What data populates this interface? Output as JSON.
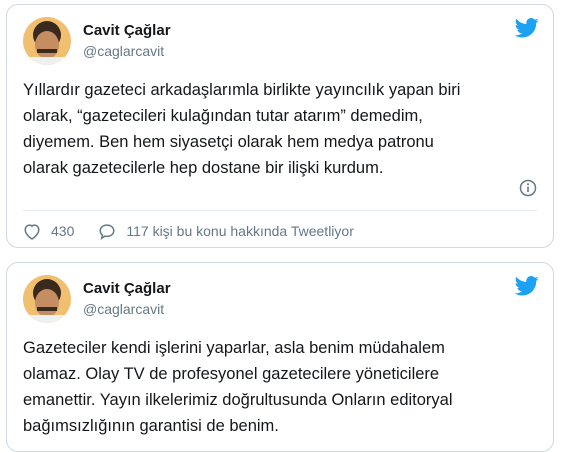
{
  "tweets": [
    {
      "author_name": "Cavit Çağlar",
      "author_handle": "@caglarcavit",
      "text": "Yıllardır gazeteci arkadaşlarımla birlikte yayıncılık yapan biri\nolarak, “gazetecileri kulağından tutar atarım” demedim,\ndiyemem. Ben hem siyasetçi olarak hem medya patronu\nolarak gazetecilerle hep dostane bir ilişki kurdum.",
      "like_count": "430",
      "reply_text": "117 kişi bu konu hakkında Tweetliyor"
    },
    {
      "author_name": "Cavit Çağlar",
      "author_handle": "@caglarcavit",
      "text": "Gazeteciler kendi işlerini yaparlar, asla benim müdahalem\nolamaz. Olay TV de profesyonel gazetecilere yöneticilere\nemanettir. Yayın ilkelerimiz doğrultusunda Onların editoryal\nbağımsızlığının garantisi de benim."
    }
  ],
  "colors": {
    "accent": "#1da1f2",
    "muted": "#657786",
    "border": "#cfd9de"
  },
  "icons": [
    "twitter-bird-icon",
    "info-icon",
    "heart-icon",
    "comment-icon"
  ]
}
